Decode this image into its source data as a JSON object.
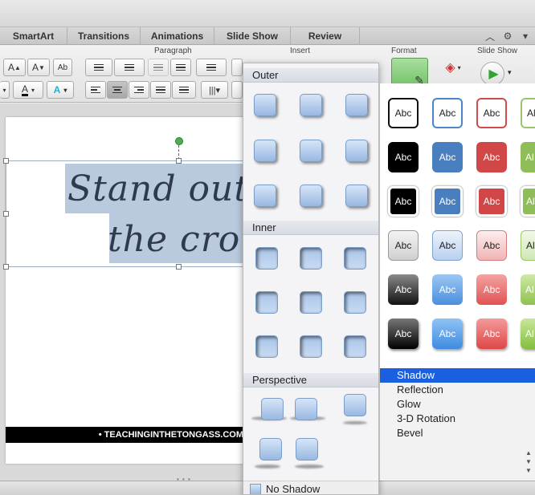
{
  "ribbon_tabs": [
    "SmartArt",
    "Transitions",
    "Animations",
    "Slide Show",
    "Review"
  ],
  "ribbon": {
    "groups": {
      "paragraph": "Paragraph",
      "insert": "Insert",
      "format": "Format",
      "slide_show": "Slide Show"
    },
    "font_grow": "A",
    "font_shrink": "A",
    "spelling": "Ab",
    "font_color": "A",
    "text_effects": "A"
  },
  "slide": {
    "title_line1": "Stand out fr",
    "title_line2": "the crowd",
    "footer": "• TEACHINGINTHETONGASS.COM"
  },
  "shadow_menu": {
    "sections": {
      "outer": "Outer",
      "inner": "Inner",
      "perspective": "Perspective"
    },
    "no_shadow": "No Shadow"
  },
  "style_gallery": {
    "sample_text": "Abc",
    "visible_text": [
      "Abc",
      "Abc",
      "Abc",
      "Al"
    ]
  },
  "effects_menu": {
    "items": [
      "Shadow",
      "Reflection",
      "Glow",
      "3-D Rotation",
      "Bevel"
    ],
    "selected": "Shadow"
  },
  "colors": {
    "accent_select": "#1a5fe0",
    "slide_text": "#2f3b4c",
    "text_highlight": "#b9c9de",
    "preset_blue": "#98b8e2"
  }
}
